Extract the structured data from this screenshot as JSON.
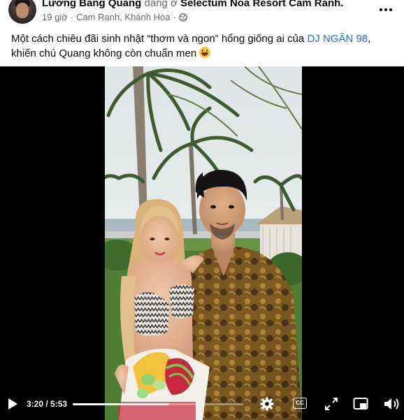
{
  "post": {
    "author": "Lương Bằng Quang",
    "at_text": "đang ở",
    "location_name": "Selectum Noa Resort Cam Ranh.",
    "time_ago": "19 giờ",
    "separator": "·",
    "place": "Cam Ranh, Khánh Hòa",
    "separator2": "·",
    "audience_icon": "globe-icon",
    "more_icon": "more-options-icon"
  },
  "caption": {
    "text_before": "Một cách chiêu đãi sinh nhật “thơm và ngon” hổng giống ai của ",
    "mention": "DJ NGÂN 98",
    "text_after": ", khiến chú Quang không còn chuẩn men ",
    "emoji": "grinning-face-emoji"
  },
  "video": {
    "current_time": "3:20",
    "time_sep": " / ",
    "duration": "5:53",
    "progress": 0.566,
    "controls": [
      "play-icon",
      "settings-gear-icon",
      "captions-cc-icon",
      "fullscreen-icon",
      "picture-in-picture-icon",
      "volume-icon"
    ],
    "cc_label": "CC"
  },
  "colors": {
    "text": "#050505",
    "secondary_text": "#65676b",
    "link": "#216fdb",
    "video_bg": "#000000"
  }
}
